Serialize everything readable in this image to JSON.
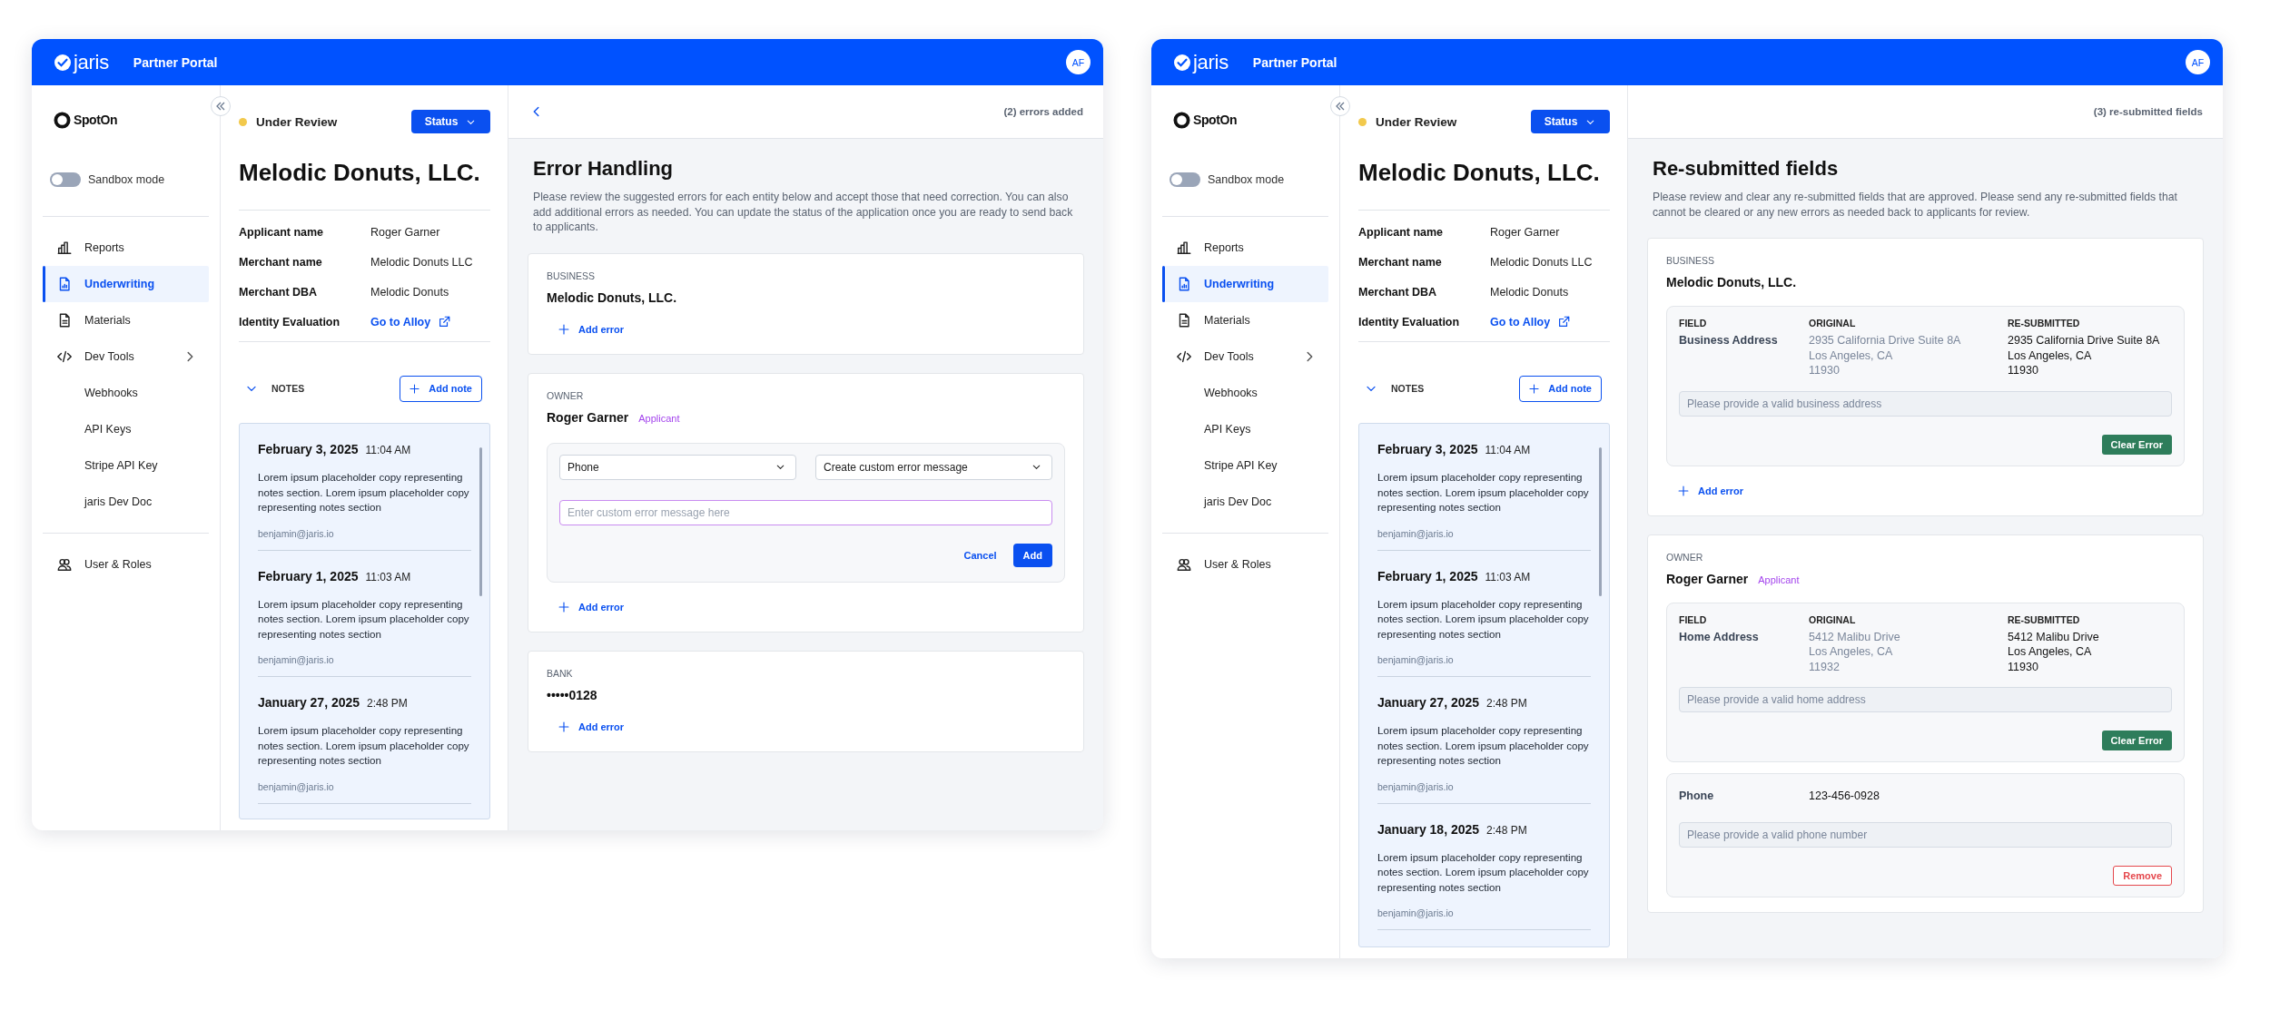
{
  "windows": [
    {
      "header": {
        "brand": "jaris",
        "title": "Partner Portal",
        "avatar": "AF"
      },
      "sidebar": {
        "logo": "SpotOn",
        "sandbox": {
          "label": "Sandbox mode",
          "on": false
        },
        "nav": [
          {
            "items": [
              {
                "label": "Reports",
                "kind": "reports",
                "selected": false
              },
              {
                "label": "Underwriting",
                "kind": "underwriting",
                "selected": true
              },
              {
                "label": "Materials",
                "kind": "materials",
                "selected": false
              },
              {
                "label": "Dev Tools",
                "kind": "dev-tools",
                "selected": false,
                "children": [
                  {
                    "label": "Webhooks",
                    "selected": false
                  },
                  {
                    "label": "API Keys",
                    "selected": false
                  },
                  {
                    "label": "Stripe API Key",
                    "selected": false
                  },
                  {
                    "label": "jaris Dev Doc",
                    "selected": false
                  }
                ]
              }
            ]
          },
          {
            "items": [
              {
                "label": "User & Roles",
                "kind": "users",
                "selected": false
              }
            ]
          }
        ]
      },
      "summary": {
        "status": {
          "label": "Under Review",
          "color": "#f2c94c"
        },
        "status_button": "Status",
        "title": "Melodic Donuts, LLC.",
        "details": [
          {
            "label": "Applicant name",
            "value": "Roger Garner",
            "kind": "text"
          },
          {
            "label": "Merchant name",
            "value": "Melodic Donuts LLC",
            "kind": "text"
          },
          {
            "label": "Merchant DBA",
            "value": "Melodic Donuts",
            "kind": "text"
          },
          {
            "label": "Identity Evaluation",
            "value": "Go to Alloy",
            "kind": "link"
          }
        ],
        "notes": {
          "label": "NOTES",
          "expanded": true,
          "add_button": "Add note",
          "items": [
            {
              "date": "February 3, 2025",
              "time": "11:04 AM",
              "body": "Lorem ipsum placeholder copy representing notes section. Lorem ipsum placeholder copy representing notes section",
              "author": "benjamin@jaris.io"
            },
            {
              "date": "February 1, 2025",
              "time": "11:03 AM",
              "body": "Lorem ipsum placeholder copy representing notes section. Lorem ipsum placeholder copy representing notes section",
              "author": "benjamin@jaris.io"
            },
            {
              "date": "January 27, 2025",
              "time": "2:48 PM",
              "body": "Lorem ipsum placeholder copy representing notes section. Lorem ipsum placeholder copy representing notes section",
              "author": "benjamin@jaris.io"
            }
          ]
        }
      },
      "panel": {
        "back": true,
        "counter": "(2) errors added",
        "title": "Error Handling",
        "description": "Please review the suggested errors for each entity below and accept those that need correction. You can also add additional errors as needed. You can update the status of the application once you are ready to send back to applicants.",
        "sections": [
          {
            "type": "BUSINESS",
            "name": "Melodic Donuts, LLC.",
            "add_error": "Add error"
          },
          {
            "type": "OWNER",
            "name": "Roger Garner",
            "tag": "Applicant",
            "editor": {
              "field": "Phone",
              "message_type": "Create custom error message",
              "placeholder": "Enter custom error message here",
              "cancel": "Cancel",
              "add": "Add"
            },
            "add_error": "Add error"
          },
          {
            "type": "BANK",
            "name": "•••••0128",
            "add_error": "Add error"
          }
        ]
      }
    },
    {
      "header": {
        "brand": "jaris",
        "title": "Partner Portal",
        "avatar": "AF"
      },
      "sidebar": {
        "logo": "SpotOn",
        "sandbox": {
          "label": "Sandbox mode",
          "on": false
        },
        "nav": [
          {
            "items": [
              {
                "label": "Reports",
                "kind": "reports",
                "selected": false
              },
              {
                "label": "Underwriting",
                "kind": "underwriting",
                "selected": true
              },
              {
                "label": "Materials",
                "kind": "materials",
                "selected": false
              },
              {
                "label": "Dev Tools",
                "kind": "dev-tools",
                "selected": false,
                "children": [
                  {
                    "label": "Webhooks",
                    "selected": false
                  },
                  {
                    "label": "API Keys",
                    "selected": false
                  },
                  {
                    "label": "Stripe API Key",
                    "selected": false
                  },
                  {
                    "label": "jaris Dev Doc",
                    "selected": false
                  }
                ]
              }
            ]
          },
          {
            "items": [
              {
                "label": "User & Roles",
                "kind": "users",
                "selected": false
              }
            ]
          }
        ]
      },
      "summary": {
        "status": {
          "label": "Under Review",
          "color": "#f2c94c"
        },
        "status_button": "Status",
        "title": "Melodic Donuts, LLC.",
        "details": [
          {
            "label": "Applicant name",
            "value": "Roger Garner",
            "kind": "text"
          },
          {
            "label": "Merchant name",
            "value": "Melodic Donuts LLC",
            "kind": "text"
          },
          {
            "label": "Merchant DBA",
            "value": "Melodic Donuts",
            "kind": "text"
          },
          {
            "label": "Identity Evaluation",
            "value": "Go to Alloy",
            "kind": "link"
          }
        ],
        "notes": {
          "label": "NOTES",
          "expanded": true,
          "add_button": "Add note",
          "items": [
            {
              "date": "February 3, 2025",
              "time": "11:04 AM",
              "body": "Lorem ipsum placeholder copy representing notes section. Lorem ipsum placeholder copy representing notes section",
              "author": "benjamin@jaris.io"
            },
            {
              "date": "February 1, 2025",
              "time": "11:03 AM",
              "body": "Lorem ipsum placeholder copy representing notes section. Lorem ipsum placeholder copy representing notes section",
              "author": "benjamin@jaris.io"
            },
            {
              "date": "January 27, 2025",
              "time": "2:48 PM",
              "body": "Lorem ipsum placeholder copy representing notes section. Lorem ipsum placeholder copy representing notes section",
              "author": "benjamin@jaris.io"
            },
            {
              "date": "January 18, 2025",
              "time": "2:48 PM",
              "body": "Lorem ipsum placeholder copy representing notes section. Lorem ipsum placeholder copy representing notes section",
              "author": "benjamin@jaris.io"
            }
          ]
        }
      },
      "panel": {
        "back": false,
        "counter": "(3) re-submitted fields",
        "title": "Re-submitted fields",
        "description": "Please review and clear any re-submitted fields that are approved. Please send any re-submitted fields that cannot be cleared or any new errors as needed back to applicants for review.",
        "sections": [
          {
            "type": "BUSINESS",
            "name": "Melodic Donuts, LLC.",
            "fields": [
              {
                "kind": "compare",
                "columns": [
                  "FIELD",
                  "ORIGINAL",
                  "RE-SUBMITTED"
                ],
                "field": "Business Address",
                "original": [
                  "2935 California Drive Suite 8A",
                  "Los Angeles, CA",
                  "11930"
                ],
                "resubmitted": [
                  "2935 California Drive Suite 8A",
                  "Los Angeles, CA",
                  "11930"
                ],
                "message": "Please provide a valid business address",
                "action": {
                  "label": "Clear Error",
                  "kind": "clear"
                }
              }
            ],
            "add_error": "Add error"
          },
          {
            "type": "OWNER",
            "name": "Roger Garner",
            "tag": "Applicant",
            "fields": [
              {
                "kind": "compare",
                "columns": [
                  "FIELD",
                  "ORIGINAL",
                  "RE-SUBMITTED"
                ],
                "field": "Home Address",
                "original": [
                  "5412 Malibu Drive",
                  "Los Angeles, CA",
                  "11932"
                ],
                "resubmitted": [
                  "5412 Malibu Drive",
                  "Los Angeles, CA",
                  "11930"
                ],
                "message": "Please provide a valid home address",
                "action": {
                  "label": "Clear Error",
                  "kind": "clear"
                }
              },
              {
                "kind": "single",
                "field": "Phone",
                "value": "123-456-0928",
                "message": "Please provide a valid phone number",
                "action": {
                  "label": "Remove",
                  "kind": "remove"
                }
              }
            ]
          }
        ]
      }
    }
  ]
}
